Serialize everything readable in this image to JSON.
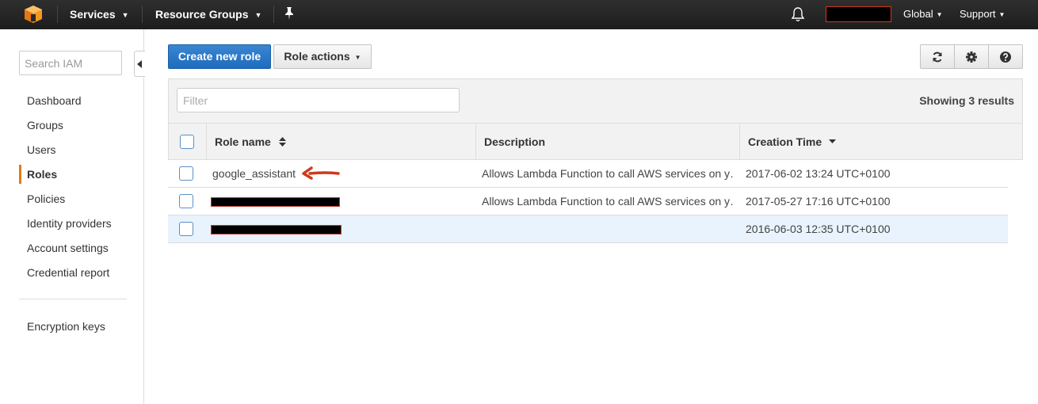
{
  "topbar": {
    "logo_icon": "aws-cube-icon",
    "services_label": "Services",
    "resource_groups_label": "Resource Groups",
    "pin_icon": "pin-icon",
    "bell_icon": "bell-icon",
    "region_label": "Global",
    "support_label": "Support",
    "brand_color": "#f7981d"
  },
  "sidebar": {
    "search_placeholder": "Search IAM",
    "items": [
      {
        "label": "Dashboard"
      },
      {
        "label": "Groups"
      },
      {
        "label": "Users"
      },
      {
        "label": "Roles",
        "active": true
      },
      {
        "label": "Policies"
      },
      {
        "label": "Identity providers"
      },
      {
        "label": "Account settings"
      },
      {
        "label": "Credential report"
      }
    ],
    "secondary_items": [
      {
        "label": "Encryption keys"
      }
    ],
    "active_color": "#e47911"
  },
  "toolbar": {
    "create_label": "Create new role",
    "actions_label": "Role actions",
    "icons": [
      "refresh-icon",
      "gear-icon",
      "help-icon"
    ]
  },
  "table": {
    "filter_placeholder": "Filter",
    "result_count": "Showing 3 results",
    "columns": {
      "role_name": "Role name",
      "description": "Description",
      "creation_time": "Creation Time"
    },
    "rows": [
      {
        "role_name": "google_assistant",
        "description": "Allows Lambda Function to call AWS services on y…",
        "creation_time": "2017-06-02 13:24 UTC+0100"
      },
      {
        "role_name": "",
        "description": "Allows Lambda Function to call AWS services on y…",
        "creation_time": "2017-05-27 17:16 UTC+0100"
      },
      {
        "role_name": "",
        "description": "",
        "creation_time": "2016-06-03 12:35 UTC+0100"
      }
    ]
  }
}
